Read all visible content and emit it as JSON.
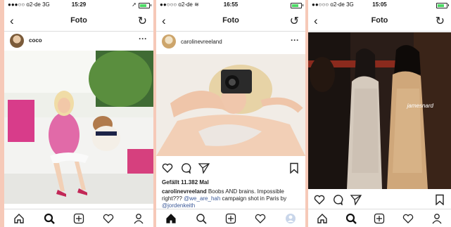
{
  "panels": [
    {
      "status": {
        "carrier": "●●●○○ o2-de",
        "network": "3G",
        "time": "15:29"
      },
      "nav": {
        "title": "Foto"
      },
      "user": {
        "name": "coco"
      }
    },
    {
      "status": {
        "carrier": "●●○○○ o2-de",
        "network": "",
        "time": "16:55"
      },
      "nav": {
        "title": "Foto"
      },
      "user": {
        "name": "carolinevreeland"
      },
      "likes": "Gefällt 11.382 Mal",
      "caption": {
        "user": "carolinevreeland",
        "text": " Boobs AND brains. Impossible right??? ",
        "mention1": "@we_are_hah",
        "text2": " campaign shot in Paris by ",
        "mention2": "@jordenkeith"
      }
    },
    {
      "status": {
        "carrier": "●●○○○ o2-de",
        "network": "3G",
        "time": "15:05"
      },
      "nav": {
        "title": "Foto"
      },
      "watermark": "jamesnard"
    }
  ],
  "icons": [
    "chevron-left-icon",
    "refresh-icon",
    "more-icon",
    "home-icon",
    "search-icon",
    "add-icon",
    "heart-icon",
    "profile-icon",
    "comment-icon",
    "send-icon",
    "bookmark-icon"
  ]
}
